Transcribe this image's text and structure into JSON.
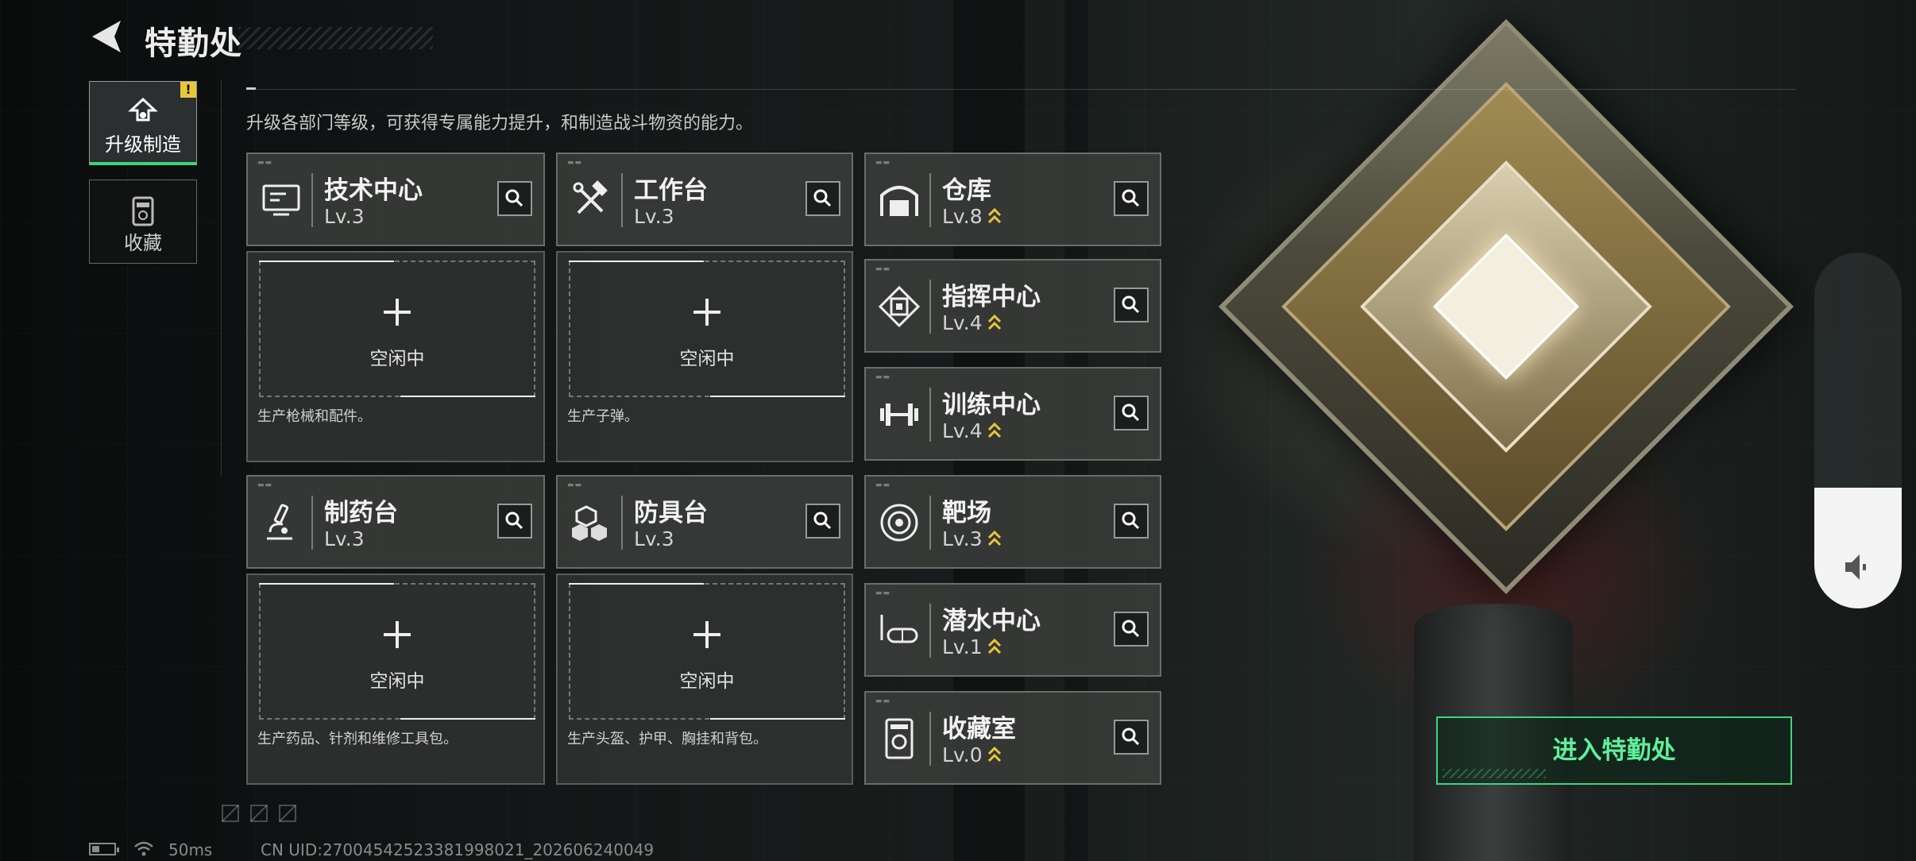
{
  "header": {
    "title": "特勤处",
    "subtitle": "升级各部门等级，可获得专属能力提升，和制造战斗物资的能力。"
  },
  "nav": [
    {
      "label": "升级制造",
      "icon": "upgrade-icon",
      "active": true,
      "badge": "!"
    },
    {
      "label": "收藏",
      "icon": "collection-icon",
      "active": false
    }
  ],
  "departments": [
    {
      "name": "技术中心",
      "level": "Lv.3",
      "icon": "tech-center-icon",
      "upgradable": false
    },
    {
      "name": "工作台",
      "level": "Lv.3",
      "icon": "workbench-icon",
      "upgradable": false
    },
    {
      "name": "仓库",
      "level": "Lv.8",
      "icon": "warehouse-icon",
      "upgradable": true
    },
    {
      "name": "指挥中心",
      "level": "Lv.4",
      "icon": "command-center-icon",
      "upgradable": true
    },
    {
      "name": "训练中心",
      "level": "Lv.4",
      "icon": "training-center-icon",
      "upgradable": true
    },
    {
      "name": "制药台",
      "level": "Lv.3",
      "icon": "pharmacy-icon",
      "upgradable": false
    },
    {
      "name": "防具台",
      "level": "Lv.3",
      "icon": "armor-bench-icon",
      "upgradable": false
    },
    {
      "name": "靶场",
      "level": "Lv.3",
      "icon": "shooting-range-icon",
      "upgradable": true
    },
    {
      "name": "潜水中心",
      "level": "Lv.1",
      "icon": "diving-center-icon",
      "upgradable": true
    },
    {
      "name": "收藏室",
      "level": "Lv.0",
      "icon": "collection-room-icon",
      "upgradable": true
    }
  ],
  "slots": [
    {
      "status": "空闲中",
      "desc": "生产枪械和配件。"
    },
    {
      "status": "空闲中",
      "desc": "生产子弹。"
    },
    {
      "status": "空闲中",
      "desc": "生产药品、针剂和维修工具包。"
    },
    {
      "status": "空闲中",
      "desc": "生产头盔、护甲、胸挂和背包。"
    }
  ],
  "enter_button": {
    "label": "进入特勤处"
  },
  "volume": {
    "level": 0.34,
    "icon": "volume-icon"
  },
  "status_bar": {
    "ping": "50ms",
    "uid": "CN UID:27004542523381998021_202606240049"
  },
  "colors": {
    "accent": "#3fd47b",
    "upgrade": "#e8c63a",
    "warning": "#e8c63a"
  }
}
